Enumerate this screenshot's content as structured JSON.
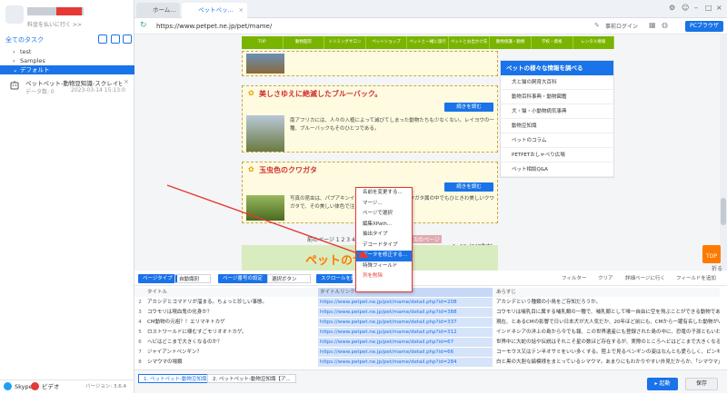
{
  "sidebar": {
    "slogan": "料金を払いに行く >>",
    "all_tasks": "全てのタスク",
    "groups": [
      {
        "label": "test",
        "expanded": false
      },
      {
        "label": "Samples",
        "expanded": false
      },
      {
        "label": "デフォルト",
        "expanded": true,
        "selected": true
      }
    ],
    "task": {
      "name": "ペットペット-動物豆知識-スクレイピング中",
      "count_label": "データ数: 0",
      "date": "2023-03-14 15:13:0"
    },
    "footer": {
      "skype": "Skype",
      "bili": "ビデオ",
      "version": "バージョン: 3.6.4"
    }
  },
  "tabs": [
    {
      "label": "ホーム...",
      "active": false
    },
    {
      "label": "ペットペッ...",
      "active": true
    }
  ],
  "address": {
    "url": "https://www.petpet.ne.jp/pet/mame/",
    "login": "事前ログイン",
    "mode": "PCブラウザ"
  },
  "web": {
    "nav": [
      "TOP",
      "動物医院",
      "トリミングサロン",
      "ペットショップ",
      "ペットと一緒に旅行",
      "ペットとお出かけ先",
      "動物保護・動物",
      "学校・資格",
      "レンタル情報"
    ],
    "articles": [
      {
        "title": "美しさゆえに絶滅したブルーバック。",
        "more": "続きを読む",
        "desc": "南アフリカには、人々の入植によって滅びてしまった動物たちも少なくない。レイヨウの一種、ブルーバックもそのひとつである。"
      },
      {
        "title": "玉虫色のクワガタ",
        "more": "続きを読む",
        "desc": "写真の昆虫は、パプアキンイロクワガタ。キンイロクワガタ属の中でもひときわ美しいクワガタで、その美しい体色で注目されています。"
      }
    ],
    "side_title": "ペットの様々な情報を調べる",
    "side_items": [
      "犬と猫の飼育大百科",
      "動物百科事典・動物図鑑",
      "犬・猫・小動物病気事典",
      "動物豆知識",
      "ペットのコラム",
      "PETPETおしゃべり広場",
      "ペット相談Q&A"
    ],
    "pager": "前のページ  1  2  3  4  5",
    "pager_next": "次のページ",
    "pager_count": "1~10（247件中）",
    "banner": "ペットのサポート！",
    "top_btn": "TOP",
    "collapse": "折る"
  },
  "context_menu": [
    "名前を変更する...",
    "マージ...",
    "ページで選択",
    "編集XPath...",
    "抽出タイプ",
    "デコードタイプ",
    "データを修正する...",
    "特殊フィールド",
    "列を削除"
  ],
  "toolbar": {
    "page_type_btn": "ページタイプ",
    "page_type_value": "自動識別",
    "page_number_btn": "ページ番号の設定",
    "page_number_value": "選択ボタン",
    "scroll_btn": "スクロールを設定",
    "filter": "フィルター",
    "clear": "クリア",
    "detail": "詳細ページに行く",
    "add_field": "フィールドを追加"
  },
  "grid": {
    "headers": [
      "タイトル",
      "タイトルリンク",
      "あらすじ"
    ],
    "rows": [
      [
        "アカシデとコマドリが溜まる。ちょっと珍しい事態。",
        "https://www.petpet.ne.jp/pet/mame/detail.php?id=208",
        "アカシデという種類の小鳥をご存知だろうか。"
      ],
      [
        "コウモリは現血鬼の化身か？",
        "https://www.petpet.ne.jp/pet/mame/detail.php?id=388",
        "コウモリは哺乳目に属する哺乳類の一種で、哺乳類として唯一自由に空を飛ぶことができる動物である。"
      ],
      [
        "CM動物の元祖？！エリマキトカゲ",
        "https://www.petpet.ne.jp/pet/mame/detail.php?id=337",
        "現在、とあるCMの影響で日い日本犬が大人気だか、20年ほど前にも、CMから一躍有名した動物がいた。エリマキトカゲ"
      ],
      [
        "ロストワールドに棲むすごモリオオトカゲ。",
        "https://www.petpet.ne.jp/pet/mame/detail.php?id=312",
        "インドネシアの洋上の島から今でも報、この世界遺産にも登録された島の中に、恐竜の子孫ともいわれるコモドオオトカゲ"
      ],
      [
        "ヘビはどこまで大きくなるのか？",
        "https://www.petpet.ne.jp/pet/mame/detail.php?id=67",
        "世界中に大蛇の話や伝説はそれこそ星の数ほど存在するが、実際のところヘビはどこまで大きくなるのだろうか。"
      ],
      [
        "ジャイアントペンギン？",
        "https://www.petpet.ne.jp/pet/mame/detail.php?id=66",
        "コーモウス又はテン半オサミをいい多くする。陸上で見るペンギンの姿はなんとも愛らしく、ピンギーはまさにそのもの"
      ],
      [
        "シマウマの場類",
        "https://www.petpet.ne.jp/pet/mame/detail.php?id=284",
        "白と黒の大胆な縞模様をまとっているシマウマ。あまりにもわかりやすい外見だからか、「シマウマ」というと"
      ]
    ]
  },
  "bottom": {
    "tabs": [
      "1. ペットペット-動物豆知識",
      "2. ペットペット-動物豆知識【ア..."
    ],
    "run": "起動",
    "save": "保存"
  }
}
